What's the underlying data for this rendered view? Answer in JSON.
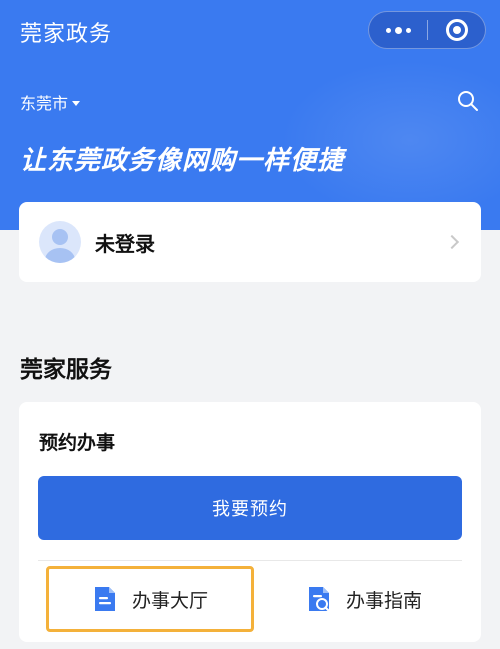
{
  "header": {
    "app_title": "莞家政务",
    "more_icon": "more-dots-icon",
    "close_icon": "record-circle-icon"
  },
  "location": {
    "city": "东莞市",
    "caret_icon": "caret-down-icon"
  },
  "search": {
    "icon": "search-icon"
  },
  "banner": {
    "slogan": "让东莞政务像网购一样便捷"
  },
  "login": {
    "status_label": "未登录",
    "avatar_icon": "user-avatar-icon",
    "chevron_icon": "chevron-right-icon"
  },
  "services": {
    "section_title": "莞家服务",
    "appointment": {
      "title": "预约办事",
      "book_button_label": "我要预约"
    },
    "entries": [
      {
        "label": "办事大厅",
        "icon": "document-icon"
      },
      {
        "label": "办事指南",
        "icon": "document-search-icon"
      }
    ]
  },
  "colors": {
    "brand_blue": "#3a7af0",
    "button_blue": "#2f6be0",
    "highlight_outline": "#f4b13a",
    "background": "#f2f3f5"
  }
}
